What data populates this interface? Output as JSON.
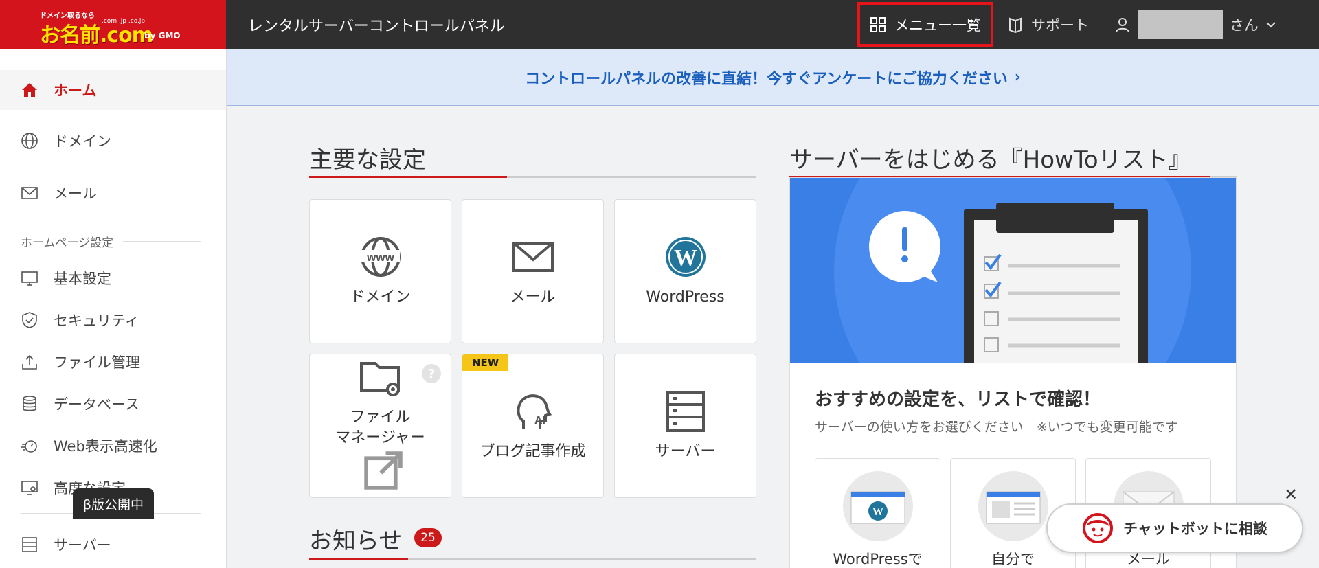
{
  "header": {
    "logo_tagline": "ドメイン取るなら",
    "logo_domains": ".com .jp .co.jp",
    "logo_main": "お名前.com",
    "logo_by": "by GMO",
    "title": "レンタルサーバーコントロールパネル",
    "menu_label": "メニュー一覧",
    "support_label": "サポート",
    "user_suffix": "さん"
  },
  "sidebar": {
    "home": "ホーム",
    "domain": "ドメイン",
    "mail": "メール",
    "section_homepage": "ホームページ設定",
    "basic": "基本設定",
    "security": "セキュリティ",
    "file": "ファイル管理",
    "database": "データベース",
    "web_speed": "Web表示高速化",
    "advanced": "高度な設定",
    "server": "サーバー",
    "beta": "β版公開中"
  },
  "banner": {
    "text": "コントロールパネルの改善に直結！今すぐアンケートにご協力ください",
    "arrow": "›"
  },
  "main_settings": {
    "title": "主要な設定",
    "tiles": [
      {
        "label": "ドメイン"
      },
      {
        "label": "メール"
      },
      {
        "label": "WordPress"
      },
      {
        "label_line1": "ファイル",
        "label_line2": "マネージャー",
        "help": "?"
      },
      {
        "label": "ブログ記事作成",
        "badge": "NEW"
      },
      {
        "label": "サーバー"
      }
    ]
  },
  "notices": {
    "title": "お知らせ",
    "count": "25"
  },
  "howto": {
    "title": "サーバーをはじめる『HowToリスト』",
    "heading": "おすすめの設定を、リストで確認！",
    "subtitle": "サーバーの使い方をお選びください　※いつでも変更可能です",
    "options": [
      {
        "label": "WordPressで"
      },
      {
        "label": "自分で"
      },
      {
        "label": "メール"
      }
    ]
  },
  "chat": {
    "label": "チャットボットに相談",
    "close": "✕"
  },
  "colors": {
    "brand_red": "#d3141c",
    "header_bg": "#2f2f2f",
    "accent_blue": "#1b5fbe",
    "howto_blue": "#3a7fe6"
  }
}
